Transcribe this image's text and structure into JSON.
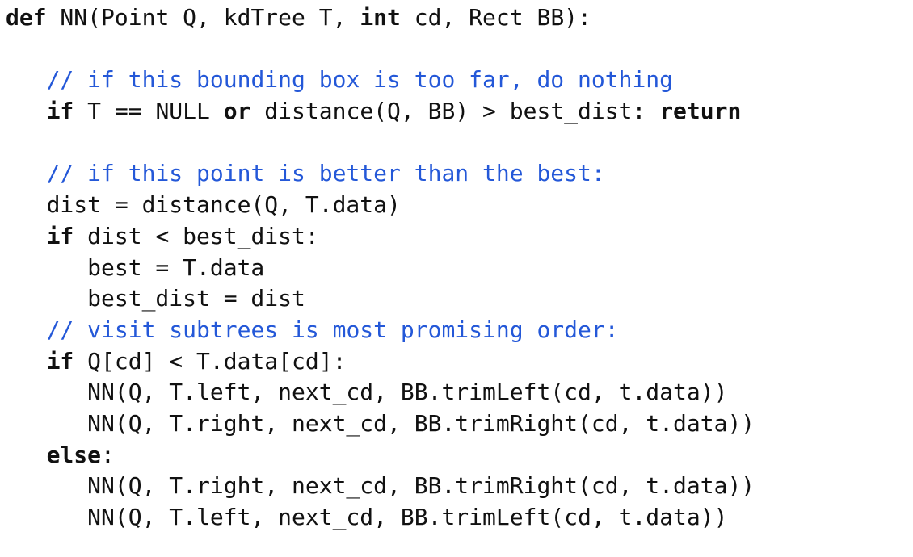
{
  "code": {
    "lines": [
      [
        {
          "t": "def",
          "s": "kw"
        },
        {
          "t": " NN(Point Q, kdTree T, ",
          "s": ""
        },
        {
          "t": "int",
          "s": "kw"
        },
        {
          "t": " cd, Rect BB):",
          "s": ""
        }
      ],
      [],
      [
        {
          "t": "   ",
          "s": ""
        },
        {
          "t": "// if this bounding box is too far, do nothing",
          "s": "cm"
        }
      ],
      [
        {
          "t": "   ",
          "s": ""
        },
        {
          "t": "if",
          "s": "kw"
        },
        {
          "t": " T == NULL ",
          "s": ""
        },
        {
          "t": "or",
          "s": "kw"
        },
        {
          "t": " distance(Q, BB) > best_dist: ",
          "s": ""
        },
        {
          "t": "return",
          "s": "kw"
        }
      ],
      [],
      [
        {
          "t": "   ",
          "s": ""
        },
        {
          "t": "// if this point is better than the best:",
          "s": "cm"
        }
      ],
      [
        {
          "t": "   dist = distance(Q, T.data)",
          "s": ""
        }
      ],
      [
        {
          "t": "   ",
          "s": ""
        },
        {
          "t": "if",
          "s": "kw"
        },
        {
          "t": " dist < best_dist:",
          "s": ""
        }
      ],
      [
        {
          "t": "      best = T.data",
          "s": ""
        }
      ],
      [
        {
          "t": "      best_dist = dist",
          "s": ""
        }
      ],
      [
        {
          "t": "   ",
          "s": ""
        },
        {
          "t": "// visit subtrees is most promising order:",
          "s": "cm"
        }
      ],
      [
        {
          "t": "   ",
          "s": ""
        },
        {
          "t": "if",
          "s": "kw"
        },
        {
          "t": " Q[cd] < T.data[cd]:",
          "s": ""
        }
      ],
      [
        {
          "t": "      NN(Q, T.left, next_cd, BB.trimLeft(cd, t.data))",
          "s": ""
        }
      ],
      [
        {
          "t": "      NN(Q, T.right, next_cd, BB.trimRight(cd, t.data))",
          "s": ""
        }
      ],
      [
        {
          "t": "   ",
          "s": ""
        },
        {
          "t": "else",
          "s": "kw"
        },
        {
          "t": ":",
          "s": ""
        }
      ],
      [
        {
          "t": "      NN(Q, T.right, next_cd, BB.trimRight(cd, t.data))",
          "s": ""
        }
      ],
      [
        {
          "t": "      NN(Q, T.left, next_cd, BB.trimLeft(cd, t.data))",
          "s": ""
        }
      ]
    ]
  },
  "colors": {
    "text": "#111111",
    "comment": "#2458d8",
    "background": "#ffffff"
  }
}
